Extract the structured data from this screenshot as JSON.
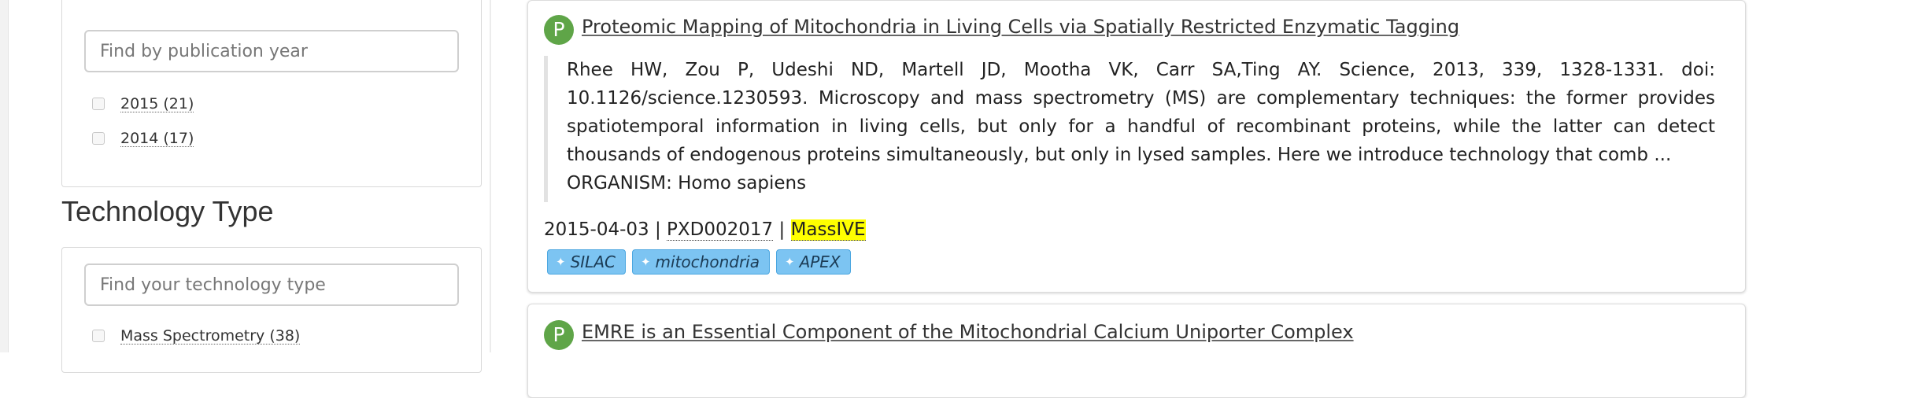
{
  "sidebar": {
    "year_filter": {
      "placeholder": "Find by publication year",
      "options": [
        {
          "label": "2015 (21)"
        },
        {
          "label": "2014 (17)"
        }
      ]
    },
    "technology_section": {
      "heading": "Technology Type",
      "placeholder": "Find your technology type",
      "options": [
        {
          "label": "Mass Spectrometry (38)"
        }
      ]
    }
  },
  "results": [
    {
      "icon_letter": "P",
      "title": "Proteomic Mapping of Mitochondria in Living Cells via Spatially Restricted Enzymatic Tagging",
      "abstract": "Rhee HW, Zou P, Udeshi ND, Martell JD, Mootha VK, Carr SA,Ting AY. Science, 2013, 339, 1328-1331. doi: 10.1126/science.1230593. Microscopy and mass spectrometry (MS) are complementary techniques: the former provides spatiotemporal information in living cells, but only for a handful of recombinant proteins, while the latter can detect thousands of endogenous proteins simultaneously, but only in lysed samples. Here we introduce technology that comb ...",
      "organism": "ORGANISM: Homo sapiens",
      "date": "2015-04-03",
      "separator": "|",
      "accession": "PXD002017",
      "repository": "MassIVE",
      "tags": [
        "SILAC",
        "mitochondria",
        "APEX"
      ]
    },
    {
      "icon_letter": "P",
      "title": "EMRE is an Essential Component of the Mitochondrial Calcium Uniporter Complex"
    }
  ],
  "colors": {
    "pub_icon": "#5fa548",
    "tag_bg": "#7cc4f2",
    "repo_highlight": "#ffff00"
  },
  "icons": {
    "pub": "publication-icon",
    "tag": "tag-icon"
  }
}
